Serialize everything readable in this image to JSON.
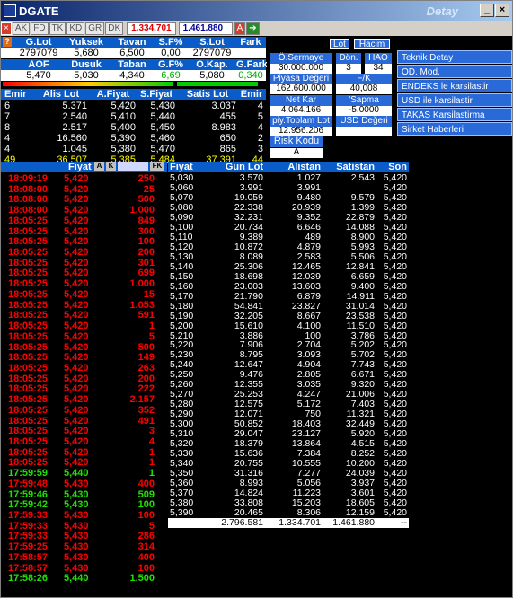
{
  "window": {
    "title": "DGATE",
    "title_right": "Detay",
    "minimize": "_",
    "maximize": "□",
    "close": "×"
  },
  "toolbar": {
    "buttons": [
      "×",
      "AK",
      "FD",
      "TK",
      "KD",
      "GR",
      "DK"
    ],
    "value1": "1.334.701",
    "value2": "1.461.880",
    "a_label": "A"
  },
  "summary": {
    "headers1": [
      "G.Lot",
      "Yuksek",
      "Tavan",
      "S.F%",
      "S.Lot",
      "Fark"
    ],
    "values1": [
      "2797079",
      "5,680",
      "6,500",
      "0,00",
      "2797079",
      ""
    ],
    "headers2": [
      "AOF",
      "Dusuk",
      "Taban",
      "G.F%",
      "O.Kap.",
      "G.Fark"
    ],
    "values2": [
      "5,470",
      "5,030",
      "4,340",
      "6,69",
      "5,080",
      "0,340"
    ]
  },
  "orders": {
    "headers": [
      "Emir",
      "Alis Lot",
      "A.Fiyat",
      "S.Fiyat",
      "Satis Lot",
      "Emir"
    ],
    "rows": [
      [
        "6",
        "5.371",
        "5,420",
        "5,430",
        "3.037",
        "4"
      ],
      [
        "7",
        "2.540",
        "5,410",
        "5,440",
        "455",
        "5"
      ],
      [
        "8",
        "2.517",
        "5,400",
        "5,450",
        "8.983",
        "4"
      ],
      [
        "4",
        "16.560",
        "5,390",
        "5,460",
        "650",
        "2"
      ],
      [
        "4",
        "1.045",
        "5,380",
        "5,470",
        "865",
        "3"
      ]
    ],
    "total": [
      "49",
      "36.507",
      "5,385",
      "5,484",
      "37.391",
      "44"
    ]
  },
  "panel": {
    "lot": "Lot",
    "hacim": "Hacim",
    "sermaye_label": "Ö.Sermaye",
    "sermaye": "30.000.000",
    "don_label": "Dön.",
    "don": "3",
    "hao_label": "HAO",
    "hao": "34",
    "piyasa_label": "Piyasa Değeri",
    "piyasa": "162.600.000",
    "fk_label": "F/K",
    "fk": "40,008",
    "netkar_label": "Net Kar",
    "netkar": "4.064.166",
    "sapma_label": "'Sapma",
    "sapma": "-5.0000",
    "toplam_label": "piy.Toplam Lot",
    "toplam": "12.956.206",
    "usd_label": "USD Değeri",
    "risk_label": "Risk Kodu",
    "risk": "A"
  },
  "menu": [
    "Teknik Detay",
    "OD. Mod.",
    "ENDEKS le karsilastir",
    "USD ile karsilastir",
    "TAKAS Karsilastirma",
    "Sirket Haberleri"
  ],
  "trades": {
    "headers": [
      "Fiyat",
      "A",
      "K",
      "FK"
    ],
    "rows": [
      [
        "18:09:19",
        "5,420",
        "250",
        "red"
      ],
      [
        "18:08:00",
        "5,420",
        "25",
        "red"
      ],
      [
        "18:08:00",
        "5,420",
        "500",
        "red"
      ],
      [
        "18:08:00",
        "5,420",
        "1.000",
        "red"
      ],
      [
        "18:05:25",
        "5,420",
        "849",
        "red"
      ],
      [
        "18:05:25",
        "5,420",
        "300",
        "red"
      ],
      [
        "18:05:25",
        "5,420",
        "100",
        "red"
      ],
      [
        "18:05:25",
        "5,420",
        "200",
        "red"
      ],
      [
        "18:05:25",
        "5,420",
        "301",
        "red"
      ],
      [
        "18:05:25",
        "5,420",
        "699",
        "red"
      ],
      [
        "18:05:25",
        "5,420",
        "1.000",
        "red"
      ],
      [
        "18:05:25",
        "5,420",
        "15",
        "red"
      ],
      [
        "18:05:25",
        "5,420",
        "1.053",
        "red"
      ],
      [
        "18:05:25",
        "5,420",
        "591",
        "red"
      ],
      [
        "18:05:25",
        "5,420",
        "1",
        "red"
      ],
      [
        "18:05:25",
        "5,420",
        "5",
        "red"
      ],
      [
        "18:05:25",
        "5,420",
        "500",
        "red"
      ],
      [
        "18:05:25",
        "5,420",
        "149",
        "red"
      ],
      [
        "18:05:25",
        "5,420",
        "263",
        "red"
      ],
      [
        "18:05:25",
        "5,420",
        "200",
        "red"
      ],
      [
        "18:05:25",
        "5,420",
        "222",
        "red"
      ],
      [
        "18:05:25",
        "5,420",
        "2.157",
        "red"
      ],
      [
        "18:05:25",
        "5,420",
        "352",
        "red"
      ],
      [
        "18:05:25",
        "5,420",
        "491",
        "red"
      ],
      [
        "18:05:25",
        "5,420",
        "3",
        "red"
      ],
      [
        "18:05:25",
        "5,420",
        "4",
        "red"
      ],
      [
        "18:05:25",
        "5,420",
        "1",
        "red"
      ],
      [
        "18:05:25",
        "5,420",
        "1",
        "red"
      ],
      [
        "17:59:59",
        "5,440",
        "1",
        "grn"
      ],
      [
        "17:59:48",
        "5,430",
        "400",
        "red"
      ],
      [
        "17:59:46",
        "5,430",
        "509",
        "grn"
      ],
      [
        "17:59:42",
        "5,430",
        "100",
        "grn"
      ],
      [
        "17:59:33",
        "5,430",
        "100",
        "red"
      ],
      [
        "17:59:33",
        "5,430",
        "5",
        "red"
      ],
      [
        "17:59:33",
        "5,430",
        "286",
        "red"
      ],
      [
        "17:59:25",
        "5,430",
        "314",
        "red"
      ],
      [
        "17:58:57",
        "5,430",
        "400",
        "red"
      ],
      [
        "17:58:57",
        "5,430",
        "100",
        "red"
      ],
      [
        "17:58:26",
        "5,440",
        "1.500",
        "grn"
      ]
    ]
  },
  "depth": {
    "headers": [
      "Fiyat",
      "Gun Lot",
      "Alistan",
      "Satistan",
      "Son"
    ],
    "rows": [
      [
        "5,030",
        "3.570",
        "1.027",
        "2.543",
        "5,420"
      ],
      [
        "5,060",
        "3.991",
        "3.991",
        "",
        "5,420"
      ],
      [
        "5,070",
        "19.059",
        "9.480",
        "9.579",
        "5,420"
      ],
      [
        "5,080",
        "22.338",
        "20.939",
        "1.399",
        "5,420"
      ],
      [
        "5,090",
        "32.231",
        "9.352",
        "22.879",
        "5,420"
      ],
      [
        "5,100",
        "20.734",
        "6.646",
        "14.088",
        "5,420"
      ],
      [
        "5,110",
        "9.389",
        "489",
        "8.900",
        "5,420"
      ],
      [
        "5,120",
        "10.872",
        "4.879",
        "5.993",
        "5,420"
      ],
      [
        "5,130",
        "8.089",
        "2.583",
        "5.506",
        "5,420"
      ],
      [
        "5,140",
        "25.306",
        "12.465",
        "12.841",
        "5,420"
      ],
      [
        "5,150",
        "18.698",
        "12.039",
        "6.659",
        "5,420"
      ],
      [
        "5,160",
        "23.003",
        "13.603",
        "9.400",
        "5,420"
      ],
      [
        "5,170",
        "21.790",
        "6.879",
        "14.911",
        "5,420"
      ],
      [
        "5,180",
        "54.841",
        "23.827",
        "31.014",
        "5,420"
      ],
      [
        "5,190",
        "32.205",
        "8.667",
        "23.538",
        "5,420"
      ],
      [
        "5,200",
        "15.610",
        "4.100",
        "11.510",
        "5,420"
      ],
      [
        "5,210",
        "3.886",
        "100",
        "3.786",
        "5,420"
      ],
      [
        "5,220",
        "7.906",
        "2.704",
        "5.202",
        "5,420"
      ],
      [
        "5,230",
        "8.795",
        "3.093",
        "5.702",
        "5,420"
      ],
      [
        "5,240",
        "12.647",
        "4.904",
        "7.743",
        "5,420"
      ],
      [
        "5,250",
        "9.476",
        "2.805",
        "6.671",
        "5,420"
      ],
      [
        "5,260",
        "12.355",
        "3.035",
        "9.320",
        "5,420"
      ],
      [
        "5,270",
        "25.253",
        "4.247",
        "21.006",
        "5,420"
      ],
      [
        "5,280",
        "12.575",
        "5.172",
        "7.403",
        "5,420"
      ],
      [
        "5,290",
        "12.071",
        "750",
        "11.321",
        "5,420"
      ],
      [
        "5,300",
        "50.852",
        "18.403",
        "32.449",
        "5,420"
      ],
      [
        "5,310",
        "29.047",
        "23.127",
        "5.920",
        "5,420"
      ],
      [
        "5,320",
        "18.379",
        "13.864",
        "4.515",
        "5,420"
      ],
      [
        "5,330",
        "15.636",
        "7.384",
        "8.252",
        "5,420"
      ],
      [
        "5,340",
        "20.755",
        "10.555",
        "10.200",
        "5,420"
      ],
      [
        "5,350",
        "31.316",
        "7.277",
        "24.039",
        "5,420"
      ],
      [
        "5,360",
        "8.993",
        "5.056",
        "3.937",
        "5,420"
      ],
      [
        "5,370",
        "14.824",
        "11.223",
        "3.601",
        "5,420"
      ],
      [
        "5,380",
        "33.808",
        "15.203",
        "18.605",
        "5,420"
      ],
      [
        "5,390",
        "20.465",
        "8.306",
        "12.159",
        "5,420"
      ]
    ],
    "total": [
      "",
      "2.796.581",
      "1.334.701",
      "1.461.880",
      "--"
    ]
  }
}
